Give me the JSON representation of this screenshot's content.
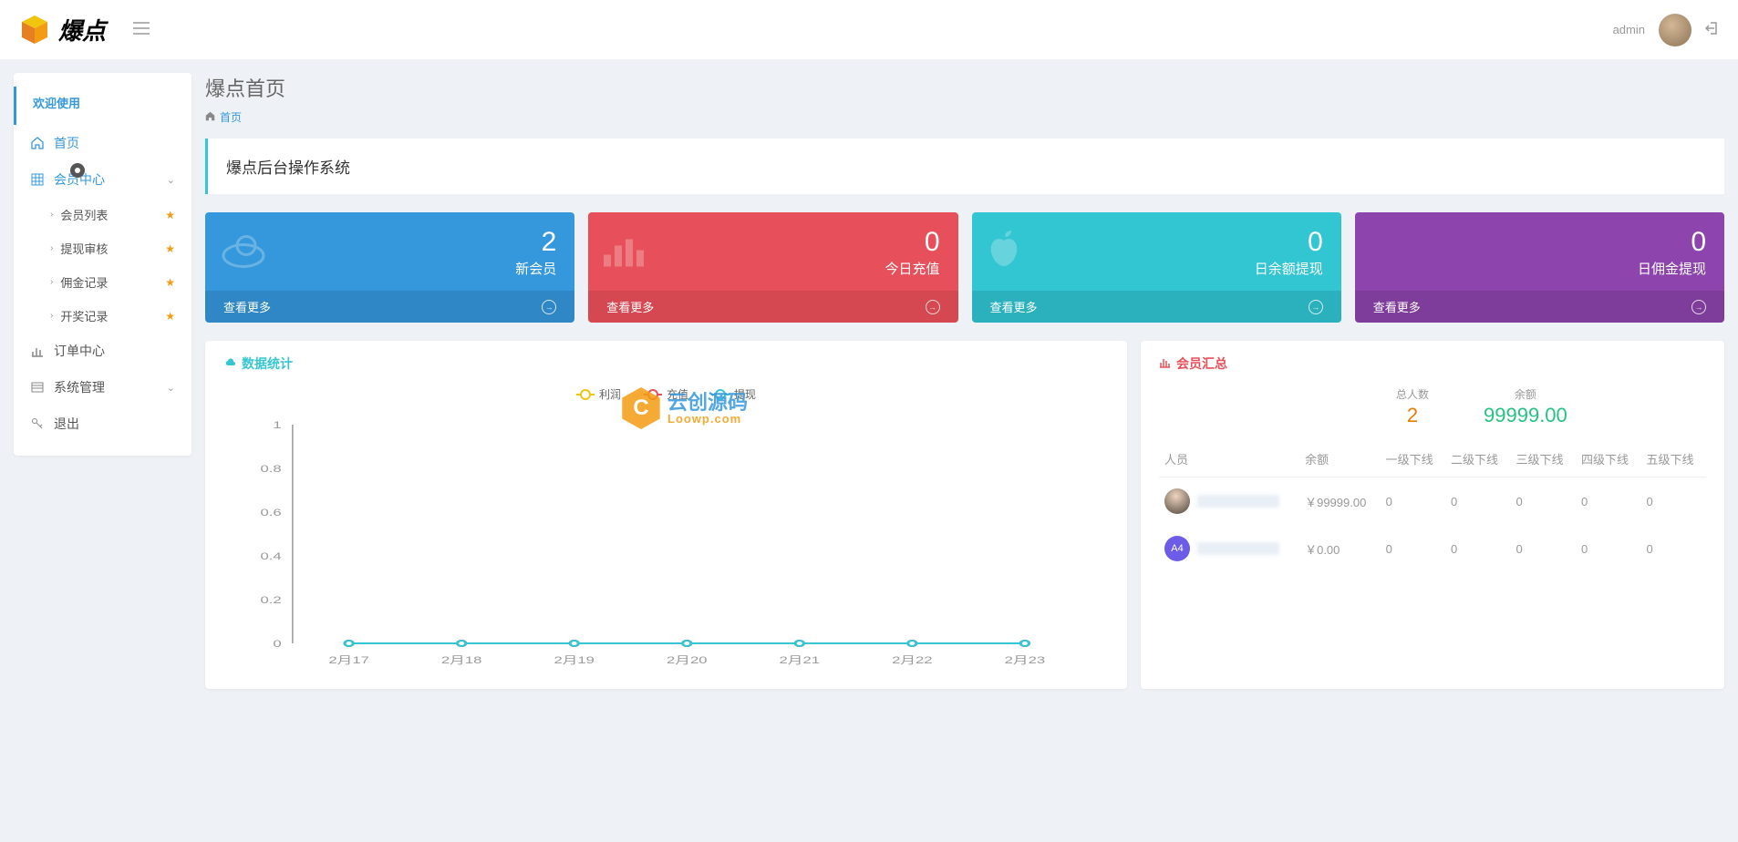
{
  "header": {
    "brand": "爆点",
    "username": "admin"
  },
  "sidebar": {
    "welcome": "欢迎使用",
    "home": "首页",
    "member_center": "会员中心",
    "member_list": "会员列表",
    "withdraw_audit": "提现审核",
    "commission_log": "佣金记录",
    "lottery_log": "开奖记录",
    "order_center": "订单中心",
    "system_mgmt": "系统管理",
    "logout": "退出"
  },
  "page": {
    "title": "爆点首页",
    "breadcrumb": "首页",
    "banner": "爆点后台操作系统"
  },
  "stats": {
    "more": "查看更多",
    "cards": [
      {
        "value": "2",
        "label": "新会员"
      },
      {
        "value": "0",
        "label": "今日充值"
      },
      {
        "value": "0",
        "label": "日余额提现"
      },
      {
        "value": "0",
        "label": "日佣金提现"
      }
    ]
  },
  "chart_panel": {
    "title": "数据统计"
  },
  "chart_data": {
    "type": "line",
    "categories": [
      "2月17",
      "2月18",
      "2月19",
      "2月20",
      "2月21",
      "2月22",
      "2月23"
    ],
    "series": [
      {
        "name": "利润",
        "values": [
          0,
          0,
          0,
          0,
          0,
          0,
          0
        ]
      },
      {
        "name": "充值",
        "values": [
          0,
          0,
          0,
          0,
          0,
          0,
          0
        ]
      },
      {
        "name": "提现",
        "values": [
          0,
          0,
          0,
          0,
          0,
          0,
          0
        ]
      }
    ],
    "ylabel": "",
    "xlabel": "",
    "ylim": [
      0,
      1
    ],
    "yticks": [
      0,
      0.2,
      0.4,
      0.6,
      0.8,
      1
    ]
  },
  "summary": {
    "title": "会员汇总",
    "total_label": "总人数",
    "total_value": "2",
    "balance_label": "余额",
    "balance_value": "99999.00",
    "columns": [
      "人员",
      "余额",
      "一级下线",
      "二级下线",
      "三级下线",
      "四级下线",
      "五级下线"
    ],
    "rows": [
      {
        "avatar_text": "",
        "balance": "￥99999.00",
        "l1": "0",
        "l2": "0",
        "l3": "0",
        "l4": "0",
        "l5": "0"
      },
      {
        "avatar_text": "A4",
        "balance": "￥0.00",
        "l1": "0",
        "l2": "0",
        "l3": "0",
        "l4": "0",
        "l5": "0"
      }
    ]
  },
  "watermark": {
    "cn": "云创源码",
    "en": "Loowp.com",
    "c": "C"
  }
}
